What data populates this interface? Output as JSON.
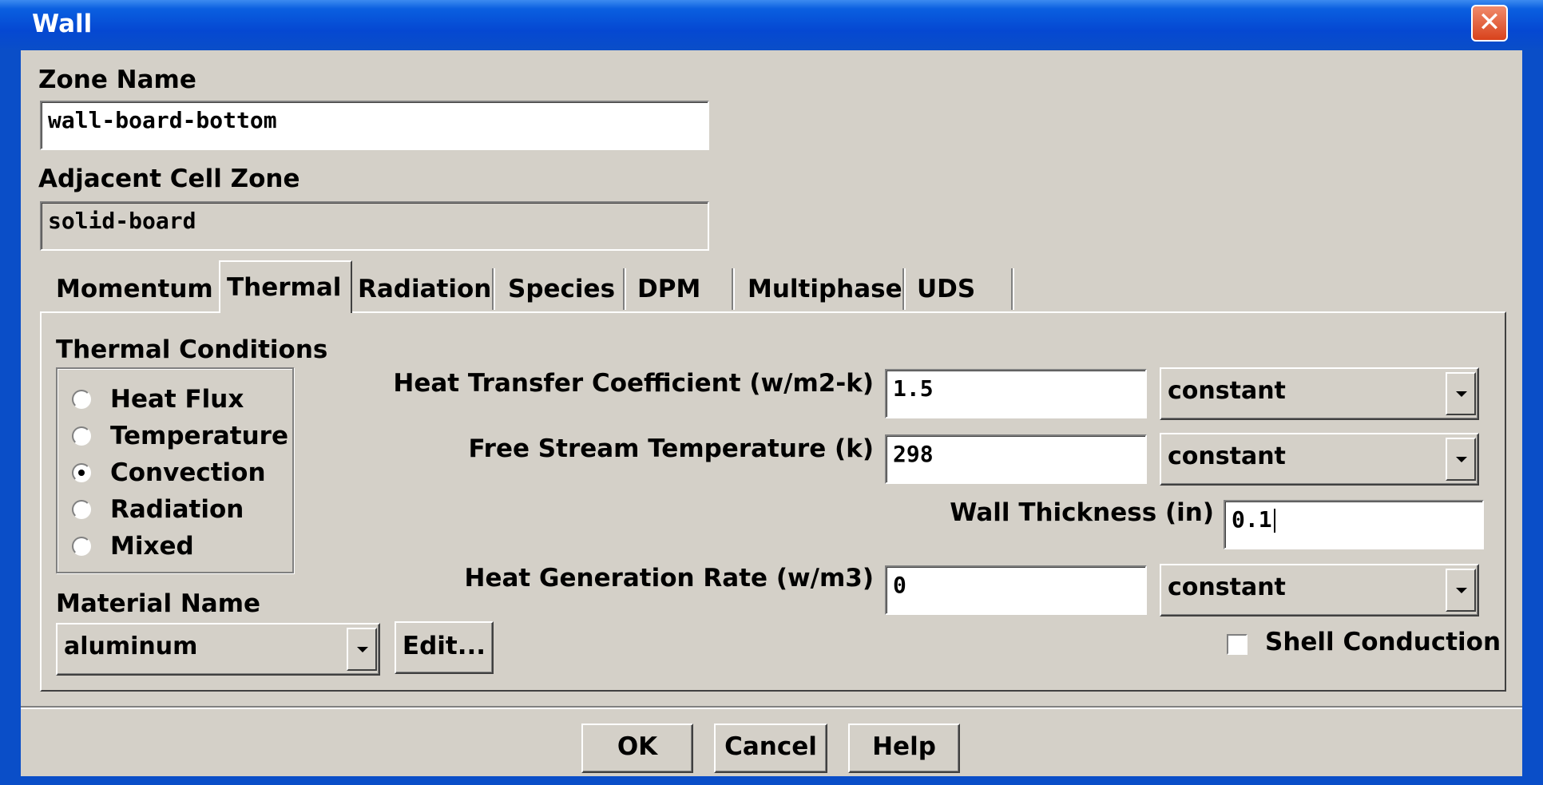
{
  "window": {
    "title": "Wall"
  },
  "zone_name": {
    "label": "Zone Name",
    "value": "wall-board-bottom"
  },
  "adjacent_cell_zone": {
    "label": "Adjacent Cell Zone",
    "value": "solid-board"
  },
  "tabs": [
    {
      "label": "Momentum",
      "active": false
    },
    {
      "label": "Thermal",
      "active": true
    },
    {
      "label": "Radiation",
      "active": false
    },
    {
      "label": "Species",
      "active": false
    },
    {
      "label": "DPM",
      "active": false
    },
    {
      "label": "Multiphase",
      "active": false
    },
    {
      "label": "UDS",
      "active": false
    }
  ],
  "thermal_conditions": {
    "label": "Thermal Conditions",
    "options": [
      "Heat Flux",
      "Temperature",
      "Convection",
      "Radiation",
      "Mixed"
    ],
    "selected": "Convection"
  },
  "material": {
    "label": "Material Name",
    "value": "aluminum",
    "edit_label": "Edit..."
  },
  "params": {
    "htc": {
      "label": "Heat Transfer Coefficient (w/m2-k)",
      "value": "1.5",
      "method": "constant"
    },
    "fst": {
      "label": "Free Stream Temperature (k)",
      "value": "298",
      "method": "constant"
    },
    "thickness": {
      "label": "Wall Thickness (in)",
      "value": "0.1"
    },
    "hgr": {
      "label": "Heat Generation Rate (w/m3)",
      "value": "0",
      "method": "constant"
    }
  },
  "shell_conduction": {
    "label": "Shell Conduction",
    "checked": false
  },
  "buttons": {
    "ok": "OK",
    "cancel": "Cancel",
    "help": "Help"
  }
}
